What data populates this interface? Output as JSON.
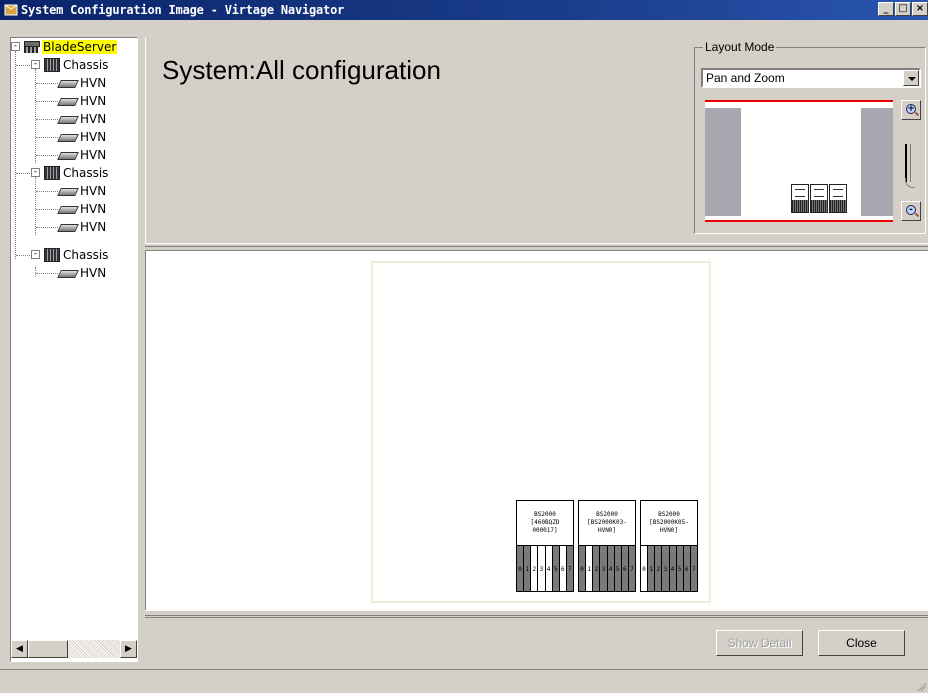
{
  "window": {
    "title": "System Configuration Image - Virtage Navigator",
    "buttons": [
      "_",
      "□",
      "×"
    ]
  },
  "tree": {
    "root": {
      "label": "BladeServer",
      "expander": "-"
    },
    "nodes": [
      {
        "label": "Chassis",
        "expander": "-",
        "children": [
          "HVN",
          "HVN",
          "HVN",
          "HVN",
          "HVN"
        ]
      },
      {
        "label": "Chassis",
        "expander": "-",
        "children": [
          "HVN",
          "HVN",
          "HVN"
        ]
      },
      {
        "label": "Chassis",
        "expander": "-",
        "children": [
          "HVN"
        ]
      }
    ]
  },
  "header": {
    "title": "System:All configuration"
  },
  "layout_mode": {
    "group_label": "Layout Mode",
    "selected": "Pan and Zoom",
    "zoom_in_symbol": "+",
    "zoom_out_symbol": "-"
  },
  "chassis_units": [
    {
      "label": "BS2000\n[460BQZD\n000017]",
      "slot_numbers": [
        "0",
        "1",
        "2",
        "3",
        "4",
        "5",
        "6",
        "7"
      ],
      "slot_states": [
        "filled",
        "filled",
        "empty",
        "empty",
        "empty",
        "filled",
        "empty",
        "filled"
      ]
    },
    {
      "label": "BS2000\n[BS2000K03-\nHVN0]",
      "slot_numbers": [
        "0",
        "1",
        "2",
        "3",
        "4",
        "5",
        "6",
        "7"
      ],
      "slot_states": [
        "filled",
        "empty",
        "filled",
        "filled",
        "filled",
        "filled",
        "filled",
        "filled"
      ]
    },
    {
      "label": "BS2000\n[BS2000K05-\nHVN0]",
      "slot_numbers": [
        "0",
        "1",
        "2",
        "3",
        "4",
        "5",
        "6",
        "7"
      ],
      "slot_states": [
        "empty",
        "filled",
        "filled",
        "filled",
        "filled",
        "filled",
        "filled",
        "filled"
      ]
    }
  ],
  "buttons": {
    "show_detail": "Show Detail",
    "close": "Close"
  },
  "colors": {
    "title_bar": "#0a246a",
    "selection_highlight": "#ffff00",
    "minimap_border": "#ee0000"
  }
}
